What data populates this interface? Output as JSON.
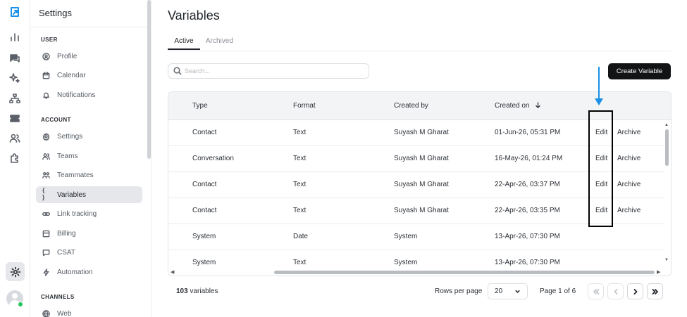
{
  "sidebar": {
    "title": "Settings",
    "sections": [
      {
        "label": "USER",
        "items": [
          {
            "label": "Profile",
            "icon": "user-circle-icon"
          },
          {
            "label": "Calendar",
            "icon": "calendar-icon"
          },
          {
            "label": "Notifications",
            "icon": "bell-icon"
          }
        ]
      },
      {
        "label": "ACCOUNT",
        "items": [
          {
            "label": "Settings",
            "icon": "gear-icon"
          },
          {
            "label": "Teams",
            "icon": "users-icon"
          },
          {
            "label": "Teammates",
            "icon": "teammates-icon"
          },
          {
            "label": "Variables",
            "icon": "braces-icon",
            "active": true
          },
          {
            "label": "Link tracking",
            "icon": "link-icon"
          },
          {
            "label": "Billing",
            "icon": "billing-icon"
          },
          {
            "label": "CSAT",
            "icon": "message-icon"
          },
          {
            "label": "Automation",
            "icon": "bolt-icon"
          }
        ]
      },
      {
        "label": "CHANNELS",
        "items": [
          {
            "label": "Web",
            "icon": "globe-icon"
          }
        ]
      }
    ]
  },
  "page": {
    "title": "Variables",
    "tabs": [
      {
        "label": "Active",
        "active": true
      },
      {
        "label": "Archived",
        "active": false
      }
    ],
    "search_placeholder": "Search...",
    "create_button": "Create Variable"
  },
  "table": {
    "columns": [
      "Type",
      "Format",
      "Created by",
      "Created on"
    ],
    "sort_column": "Created on",
    "rows": [
      {
        "type": "Contact",
        "format": "Text",
        "created_by": "Suyash M Gharat",
        "created_on": "01-Jun-26, 05:31 PM",
        "edit": "Edit",
        "archive": "Archive"
      },
      {
        "type": "Conversation",
        "format": "Text",
        "created_by": "Suyash M Gharat",
        "created_on": "16-May-26, 01:24 PM",
        "edit": "Edit",
        "archive": "Archive"
      },
      {
        "type": "Contact",
        "format": "Text",
        "created_by": "Suyash M Gharat",
        "created_on": "22-Apr-26, 03:37 PM",
        "edit": "Edit",
        "archive": "Archive"
      },
      {
        "type": "Contact",
        "format": "Text",
        "created_by": "Suyash M Gharat",
        "created_on": "22-Apr-26, 03:35 PM",
        "edit": "Edit",
        "archive": "Archive"
      },
      {
        "type": "System",
        "format": "Date",
        "created_by": "System",
        "created_on": "13-Apr-26, 07:30 PM",
        "edit": "",
        "archive": ""
      },
      {
        "type": "System",
        "format": "Text",
        "created_by": "System",
        "created_on": "13-Apr-26, 07:30 PM",
        "edit": "",
        "archive": ""
      }
    ]
  },
  "footer": {
    "count_number": "103",
    "count_suffix": "variables",
    "rows_per_page_label": "Rows per page",
    "rows_per_page_value": "20",
    "page_info": "Page 1 of 6"
  },
  "colors": {
    "annotation_arrow": "#1a91e6",
    "annotation_box": "#000000",
    "primary_button": "#111315",
    "active_nav": "#e5e7ea",
    "presence": "#22c55e"
  }
}
